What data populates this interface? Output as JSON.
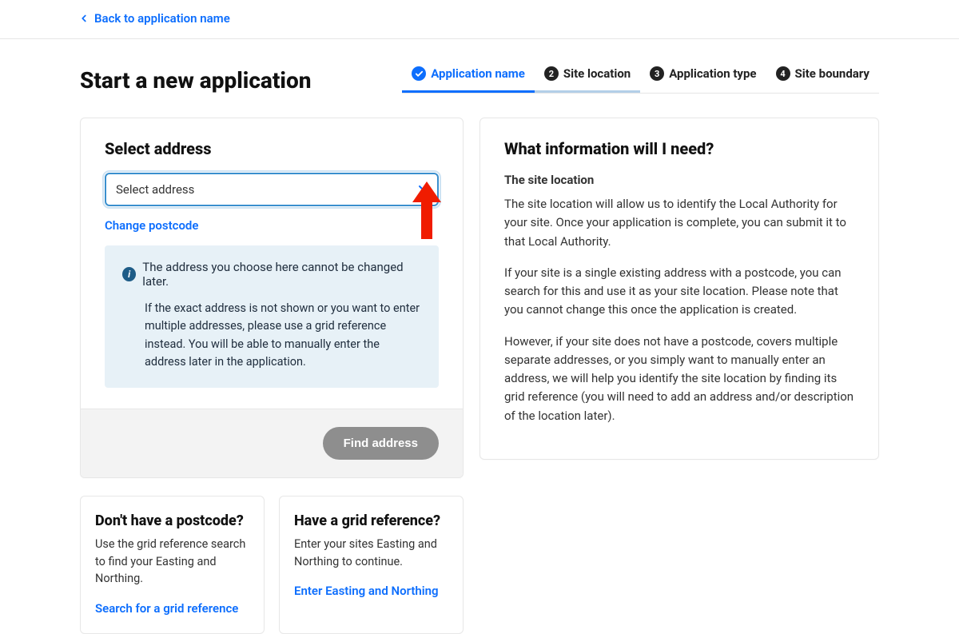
{
  "nav": {
    "back_label": "Back to application name"
  },
  "header": {
    "title": "Start a new application"
  },
  "steps": [
    {
      "label": "Application name",
      "done": true
    },
    {
      "label": "Site location",
      "active": true,
      "num": "2"
    },
    {
      "label": "Application type",
      "num": "3"
    },
    {
      "label": "Site boundary",
      "num": "4"
    }
  ],
  "address_card": {
    "title": "Select address",
    "select_placeholder": "Select address",
    "change_postcode": "Change postcode",
    "info_title": "The address you choose here cannot be changed later.",
    "info_body": "If the exact address is not shown or you want to enter multiple addresses, please use a grid reference instead. You will be able to manually enter the address later in the application.",
    "find_button": "Find address"
  },
  "side_cards": {
    "no_postcode": {
      "title": "Don't have a postcode?",
      "body": "Use the grid reference search to find your Easting and Northing.",
      "link": "Search for a grid reference"
    },
    "grid_ref": {
      "title": "Have a grid reference?",
      "body": "Enter your sites Easting and Northing to continue.",
      "link": "Enter Easting and Northing"
    }
  },
  "info_panel": {
    "title": "What information will I need?",
    "subhead": "The site location",
    "p1": "The site location will allow us to identify the Local Authority for your site. Once your application is complete, you can submit it to that Local Authority.",
    "p2": "If your site is a single existing address with a postcode, you can search for this and use it as your site location. Please note that you cannot change this once the application is created.",
    "p3": "However, if your site does not have a postcode, covers multiple separate addresses, or you simply want to manually enter an address, we will help you identify the site location by finding its grid reference (you will need to add an address and/or description of the location later)."
  }
}
